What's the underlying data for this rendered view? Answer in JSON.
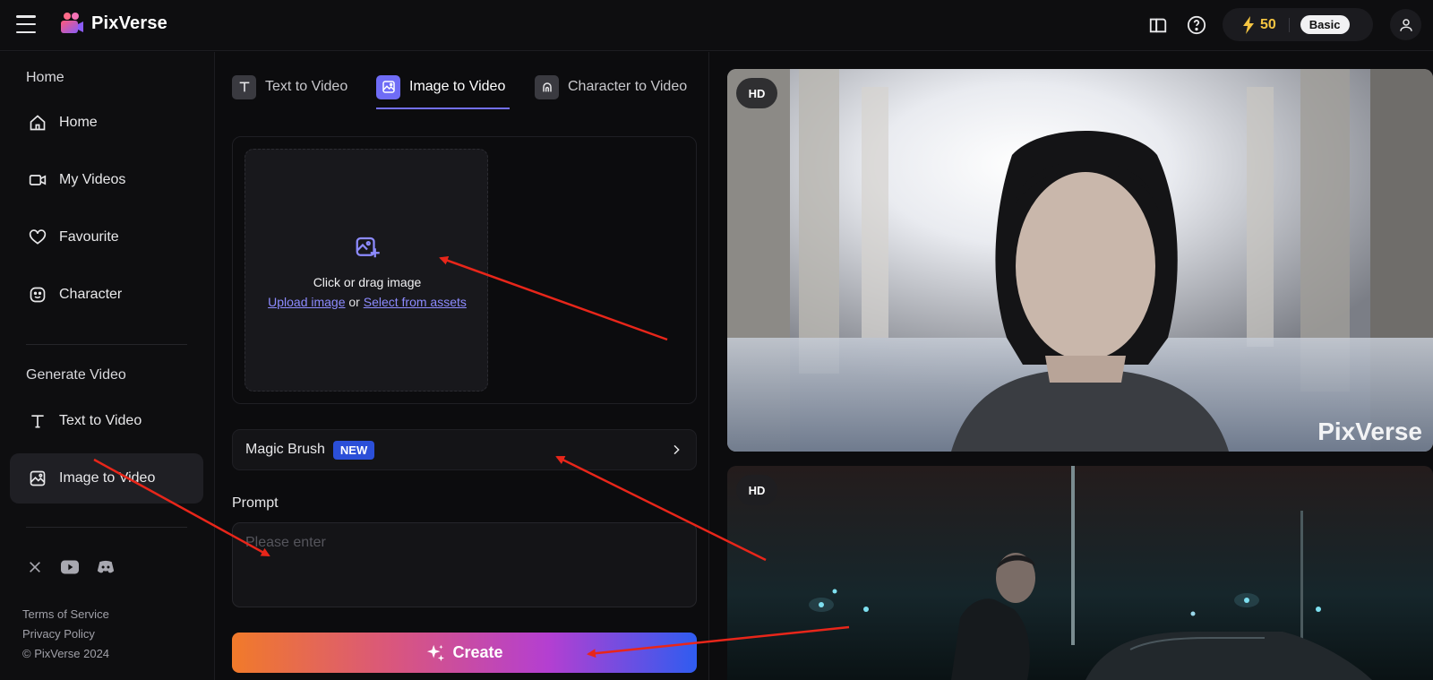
{
  "app": {
    "name": "PixVerse"
  },
  "topbar": {
    "credits": "50",
    "plan": "Basic"
  },
  "sidebar": {
    "section_home": "Home",
    "home_items": [
      {
        "label": "Home",
        "icon": "home-icon"
      },
      {
        "label": "My Videos",
        "icon": "video-camera-icon"
      },
      {
        "label": "Favourite",
        "icon": "heart-icon"
      },
      {
        "label": "Character",
        "icon": "smiley-icon"
      }
    ],
    "section_generate": "Generate Video",
    "generate_items": [
      {
        "label": "Text to Video",
        "icon": "text-icon"
      },
      {
        "label": "Image to Video",
        "icon": "image-icon",
        "active": true
      }
    ],
    "social_icons": [
      "x-icon",
      "youtube-icon",
      "discord-icon"
    ],
    "footer": {
      "terms": "Terms of Service",
      "privacy": "Privacy Policy",
      "copyright": "© PixVerse 2024"
    }
  },
  "tabs": [
    {
      "label": "Text to Video",
      "icon": "text-icon"
    },
    {
      "label": "Image to Video",
      "icon": "image-icon",
      "active": true
    },
    {
      "label": "Character to Video",
      "icon": "character-icon"
    }
  ],
  "upload": {
    "title": "Click or drag image",
    "upload_link": "Upload image",
    "or": "or",
    "assets_link": "Select from assets"
  },
  "magic_brush": {
    "label": "Magic Brush",
    "badge": "NEW"
  },
  "prompt": {
    "label": "Prompt",
    "placeholder": "Please enter"
  },
  "create": {
    "label": "Create"
  },
  "gallery": [
    {
      "badge": "HD",
      "watermark": "PixVerse"
    },
    {
      "badge": "HD"
    }
  ],
  "colors": {
    "accent": "#6f6cf6",
    "background": "#0c0c0e",
    "credit": "#f5c542",
    "new_badge": "#2b4fd8",
    "annotation": "#e8261a"
  }
}
